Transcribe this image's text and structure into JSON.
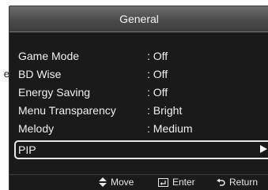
{
  "background_label": {
    "text": "e"
  },
  "header": {
    "title": "General"
  },
  "menu": {
    "items": [
      {
        "label": "Game Mode",
        "value": ": Off"
      },
      {
        "label": "BD Wise",
        "value": ": Off"
      },
      {
        "label": "Energy Saving",
        "value": ": Off"
      },
      {
        "label": "Menu Transparency",
        "value": ": Bright"
      },
      {
        "label": "Melody",
        "value": ": Medium"
      },
      {
        "label": "PIP",
        "value": "",
        "selected": true
      }
    ]
  },
  "footer": {
    "move": "Move",
    "enter": "Enter",
    "return": "Return"
  },
  "icons": {
    "move": "move-updown-icon",
    "enter": "enter-icon",
    "return": "return-icon",
    "submenu": "submenu-arrow-icon"
  },
  "colors": {
    "panel": "#1a1a1a",
    "header_top": "#6c6c6c",
    "header_bottom": "#3c3c3c",
    "text": "#f0f0f0",
    "highlight_border": "#e8e8e8"
  }
}
